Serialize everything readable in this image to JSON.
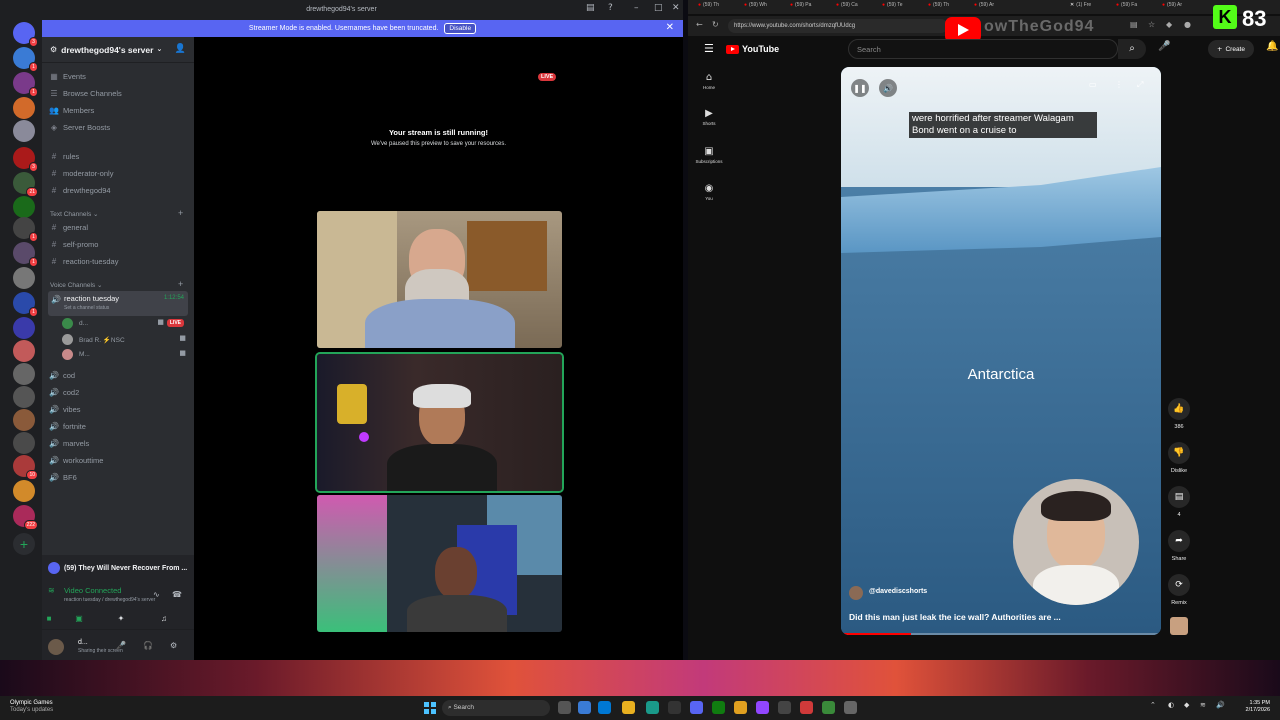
{
  "discord": {
    "window_title": "drewthegod94's server",
    "banner": {
      "text": "Streamer Mode is enabled. Usernames have been truncated.",
      "button": "Disable"
    },
    "server_name": "drewthegod94's server",
    "rail_badges": [
      "3",
      "1",
      "1",
      "3",
      "4",
      "21",
      "1",
      "1",
      "1",
      "10",
      "3",
      "222"
    ],
    "menu": [
      "Events",
      "Browse Channels",
      "Members",
      "Server Boosts"
    ],
    "text_channels_top": [
      "rules",
      "moderator-only",
      "drewthegod94"
    ],
    "category_text": "Text Channels",
    "text_channels": [
      "general",
      "self-promo",
      "reaction-tuesday"
    ],
    "category_voice": "Voice Channels",
    "active_voice": {
      "name": "reaction tuesday",
      "status": "Set a channel status",
      "timer": "1:12:54"
    },
    "voice_users": [
      {
        "name": "d...",
        "live": "LIVE"
      },
      {
        "name": "Brad R. ⚡NSC",
        "live": ""
      },
      {
        "name": "M...",
        "live": ""
      }
    ],
    "voice_channels": [
      "cod",
      "cod2",
      "vibes",
      "fortnite",
      "marvels",
      "workouttime",
      "BF6"
    ],
    "activity": "(59) They Will Never Recover From ...",
    "rtc": {
      "status": "Video Connected",
      "sub": "reaction tuesday / drewthegod94's server"
    },
    "user": {
      "name": "d...",
      "status": "Sharing their screen"
    },
    "stage": {
      "live": "LIVE",
      "title": "Your stream is still running!",
      "subtitle": "We've paused this preview to save your resources."
    }
  },
  "browser": {
    "tabs": [
      "(59) Th",
      "(59) Wh",
      "(59) Pa",
      "(59) Ca",
      "(59) Te",
      "(59) Th",
      "(59) Ar",
      "(1) Fre",
      "(59) Fa",
      "(59) Ar"
    ],
    "url": "https://www.youtube.com/shorts/dmzqfUUdcg",
    "watermark": "owTheGod94",
    "kick_count": "83"
  },
  "youtube": {
    "logo": "YouTube",
    "search_placeholder": "Search",
    "create": "Create",
    "sidebar": [
      "Home",
      "Shorts",
      "Subscriptions",
      "You"
    ],
    "caption": "were horrified after streamer Walagam Bond went on a cruise to",
    "location_text": "Antarctica",
    "channel": "@davediscshorts",
    "title": "Did this man just leak the ice wall? Authorities are ...",
    "actions": [
      {
        "icon": "like-icon",
        "label": "386"
      },
      {
        "icon": "dislike-icon",
        "label": "Dislike"
      },
      {
        "icon": "comment-icon",
        "label": "4"
      },
      {
        "icon": "share-icon",
        "label": "Share"
      },
      {
        "icon": "remix-icon",
        "label": "Remix"
      }
    ],
    "progress": 0.22
  },
  "taskbar": {
    "news_title": "Olympic Games",
    "news_sub": "Today's updates",
    "search": "Search",
    "time": "1:35 PM",
    "date": "2/17/2026"
  }
}
